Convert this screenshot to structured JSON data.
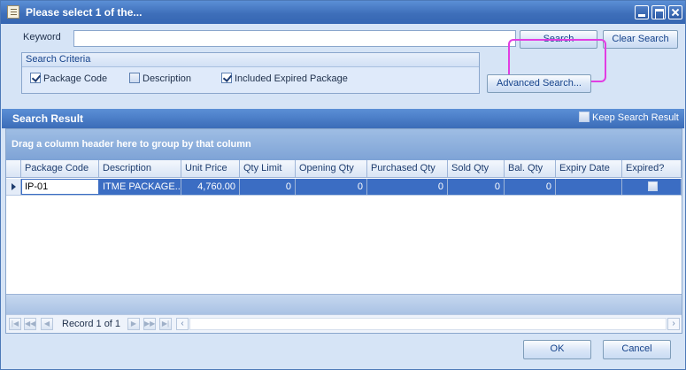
{
  "window": {
    "title": "Please select 1 of the...",
    "accent_color": "#3e6fba"
  },
  "search": {
    "keyword_label": "Keyword",
    "keyword_value": "",
    "search_label": "Search",
    "clear_label": "Clear Search",
    "advanced_label": "Advanced Search..."
  },
  "criteria": {
    "title": "Search Criteria",
    "options": [
      {
        "label": "Package Code",
        "checked": true
      },
      {
        "label": "Description",
        "checked": false
      },
      {
        "label": "Included Expired Package",
        "checked": true
      }
    ]
  },
  "result": {
    "title": "Search Result",
    "keep_label": "Keep Search Result",
    "group_hint": "Drag a column header here to group by that column",
    "columns": [
      "Package Code",
      "Description",
      "Unit Price",
      "Qty Limit",
      "Opening Qty",
      "Purchased Qty",
      "Sold Qty",
      "Bal. Qty",
      "Expiry Date",
      "Expired?"
    ],
    "rows": [
      {
        "package_code": "IP-01",
        "description": "ITME PACKAGE...",
        "unit_price": "4,760.00",
        "qty_limit": "0",
        "opening_qty": "0",
        "purchased_qty": "0",
        "sold_qty": "0",
        "bal_qty": "0",
        "expiry_date": "",
        "expired": false
      }
    ]
  },
  "navigator": {
    "record_text": "Record 1 of 1"
  },
  "footer": {
    "ok_label": "OK",
    "cancel_label": "Cancel"
  }
}
